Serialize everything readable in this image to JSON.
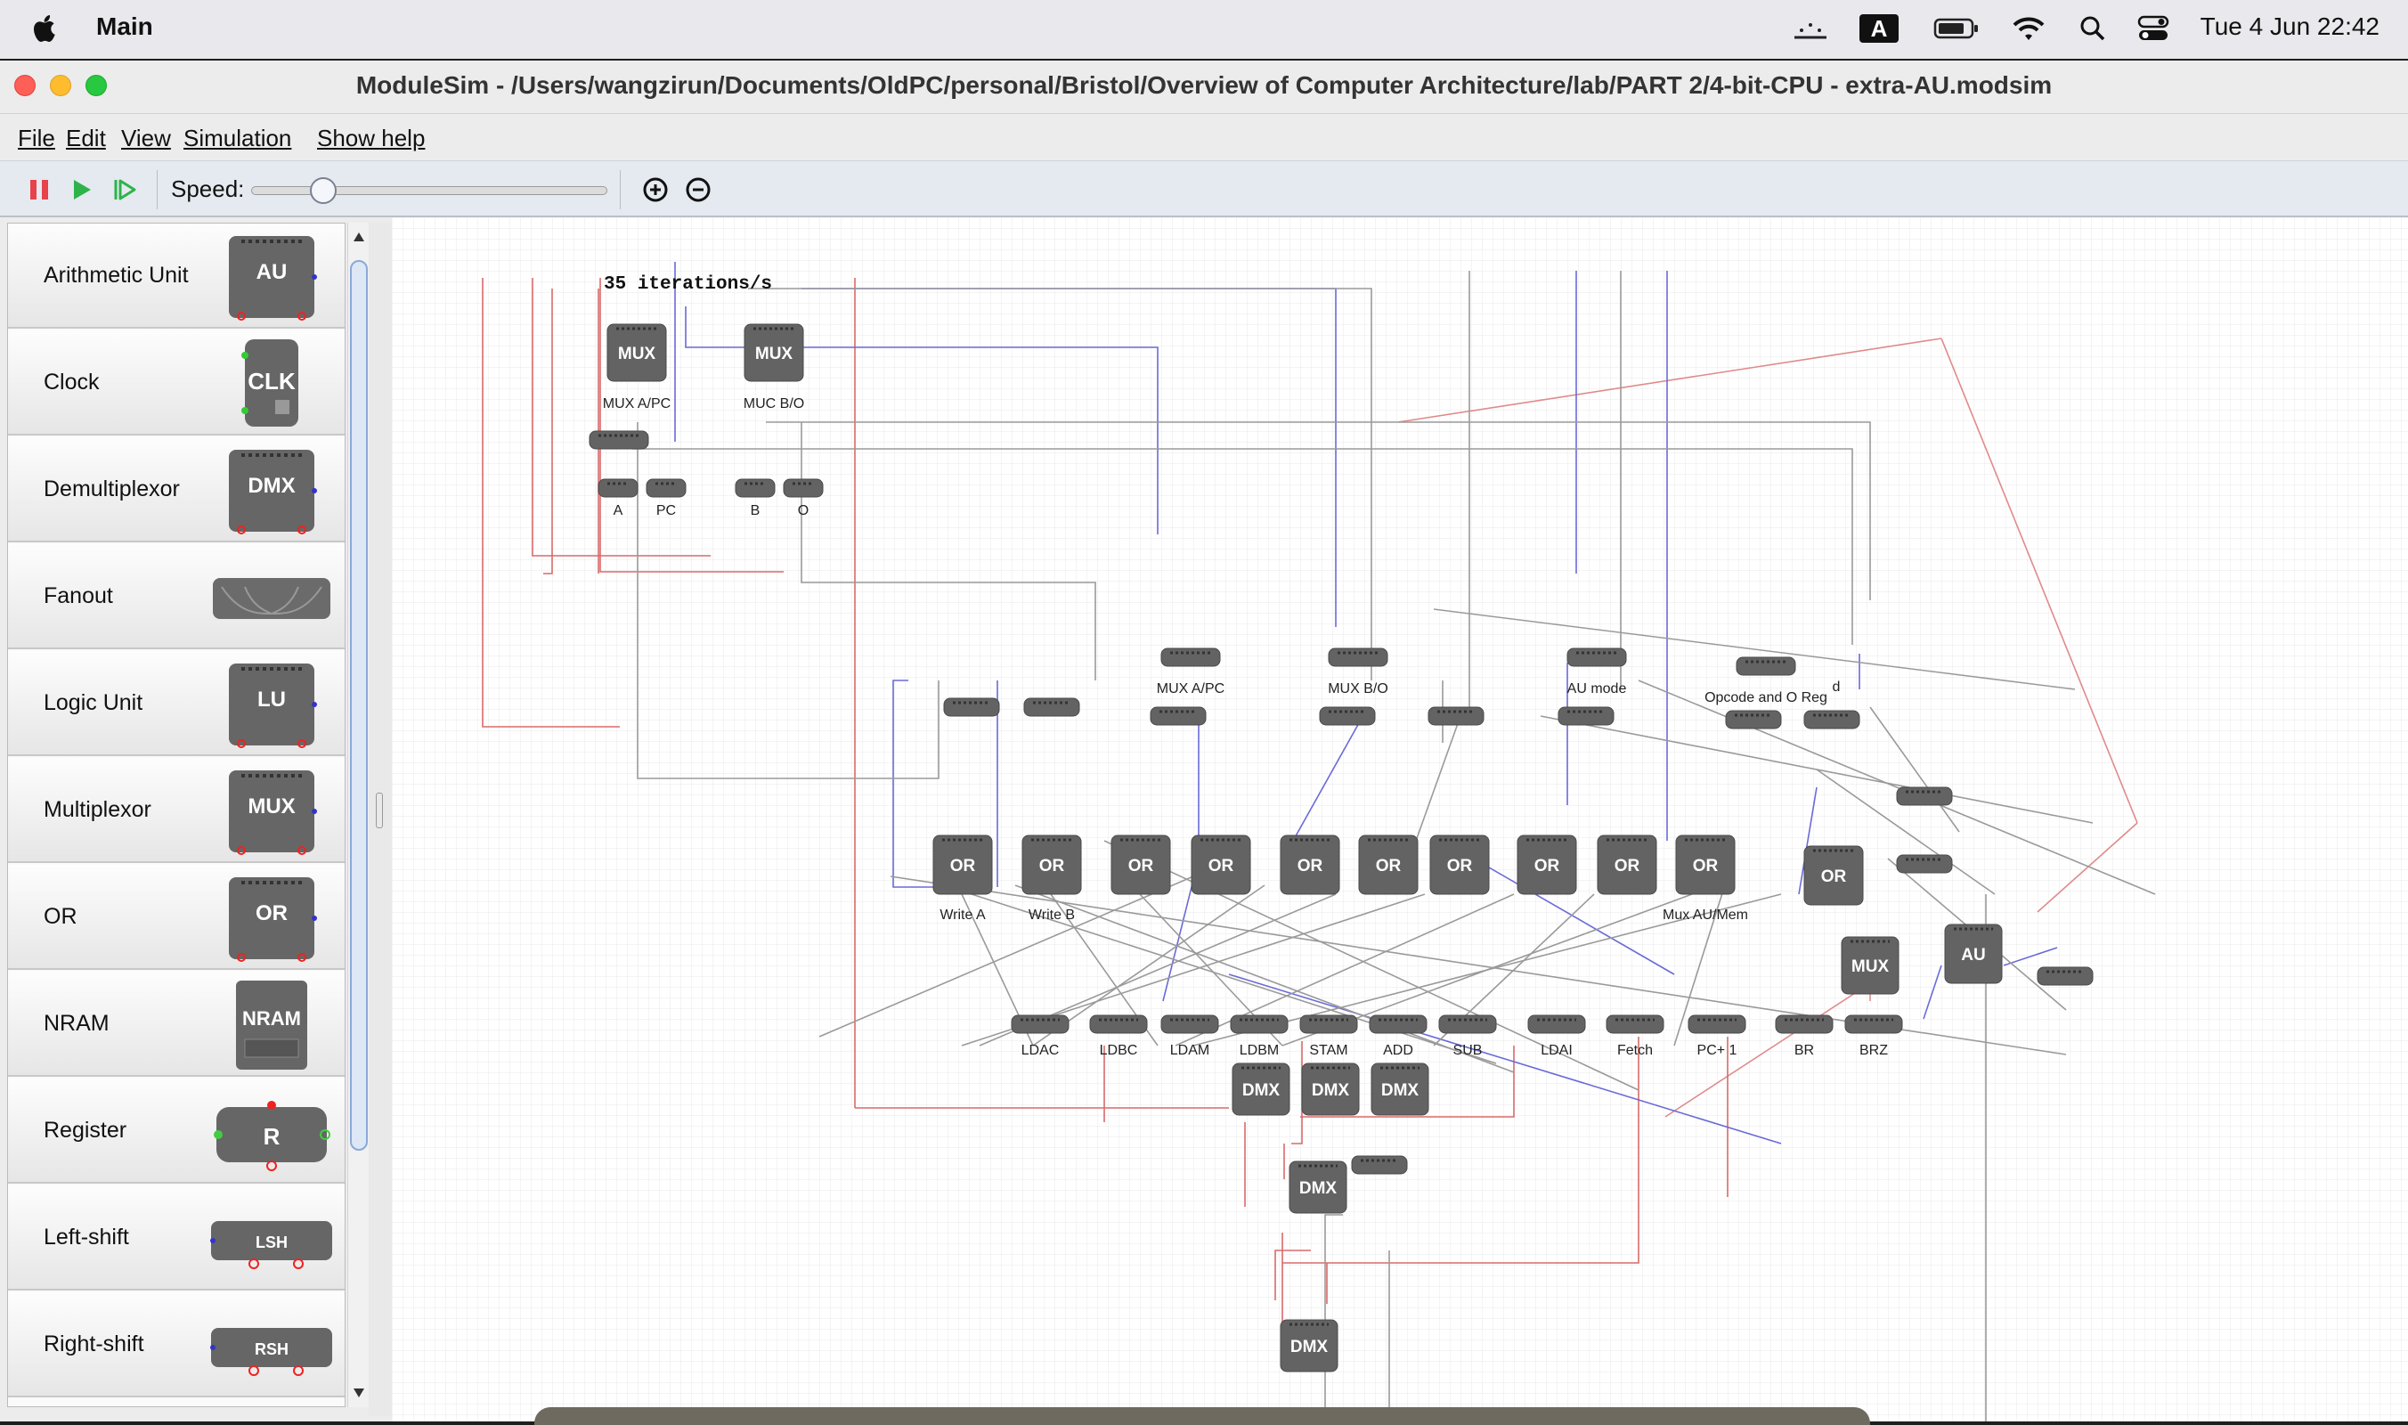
{
  "menubar": {
    "app_name": "Main",
    "keyboard_badge": "A",
    "datetime": "Tue 4 Jun  22:42",
    "icons": [
      "apple-icon",
      "mirroring-icon",
      "input-source-icon",
      "battery-icon",
      "wifi-icon",
      "search-icon",
      "control-center-icon"
    ]
  },
  "window": {
    "title": "ModuleSim - /Users/wangzirun/Documents/OldPC/personal/Bristol/Overview of Computer Architecture/lab/PART 2/4-bit-CPU - extra-AU.modsim"
  },
  "menus": {
    "file": "File",
    "edit": "Edit",
    "view": "View",
    "simulation": "Simulation",
    "help": "Show help"
  },
  "toolbar": {
    "speed_label": "Speed:",
    "speed_value": 0.2
  },
  "palette": [
    {
      "label": "Arithmetic Unit",
      "icon": "AU"
    },
    {
      "label": "Clock",
      "icon": "CLK"
    },
    {
      "label": "Demultiplexor",
      "icon": "DMX"
    },
    {
      "label": "Fanout",
      "icon": ""
    },
    {
      "label": "Logic Unit",
      "icon": "LU"
    },
    {
      "label": "Multiplexor",
      "icon": "MUX"
    },
    {
      "label": "OR",
      "icon": "OR"
    },
    {
      "label": "NRAM",
      "icon": "NRAM"
    },
    {
      "label": "Register",
      "icon": "R"
    },
    {
      "label": "Left-shift",
      "icon": "LSH"
    },
    {
      "label": "Right-shift",
      "icon": "RSH"
    }
  ],
  "canvas": {
    "status": "35 iterations/s",
    "top_muxes": [
      {
        "text": "MUX",
        "label": "MUX A/PC"
      },
      {
        "text": "MUX",
        "label": "MUC B/O"
      }
    ],
    "registers": [
      "A",
      "PC",
      "B",
      "O"
    ],
    "control_labels": [
      "MUX A/PC",
      "MUX B/O",
      "AU mode",
      "Opcode and O Reg",
      "d"
    ],
    "or_gates": [
      {
        "text": "OR",
        "label": "Write A"
      },
      {
        "text": "OR",
        "label": "Write B"
      },
      {
        "text": "OR",
        "label": ""
      },
      {
        "text": "OR",
        "label": ""
      },
      {
        "text": "OR",
        "label": ""
      },
      {
        "text": "OR",
        "label": ""
      },
      {
        "text": "OR",
        "label": ""
      },
      {
        "text": "OR",
        "label": ""
      },
      {
        "text": "OR",
        "label": ""
      },
      {
        "text": "OR",
        "label": "Mux AU/Mem"
      },
      {
        "text": "OR",
        "label": ""
      }
    ],
    "instructions": [
      "LDAC",
      "LDBC",
      "LDAM",
      "LDBM",
      "STAM",
      "ADD",
      "SUB",
      "LDAI",
      "Fetch",
      "PC+ 1",
      "BR",
      "BRZ"
    ],
    "dmx_text": "DMX",
    "mux_text": "MUX",
    "au_text": "AU"
  }
}
